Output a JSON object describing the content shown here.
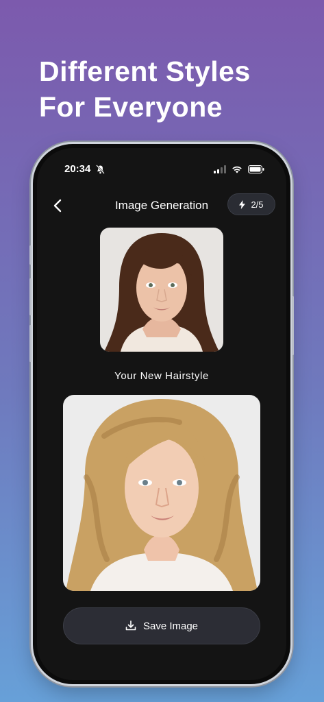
{
  "headline": {
    "line1": "Different Styles",
    "line2": "For Everyone"
  },
  "status_bar": {
    "time": "20:34"
  },
  "nav": {
    "title": "Image Generation",
    "credits": "2/5"
  },
  "original_photo": {
    "subject": "woman-with-brown-bangs-portrait"
  },
  "caption": "Your New Hairstyle",
  "result_photo": {
    "subject": "woman-with-blonde-curly-hair-portrait"
  },
  "save_button": {
    "label": "Save Image"
  },
  "colors": {
    "screen_bg": "#141414",
    "button_bg": "#2c2d35",
    "gradient_top": "#7c5aad",
    "gradient_bottom": "#67a0d8"
  }
}
